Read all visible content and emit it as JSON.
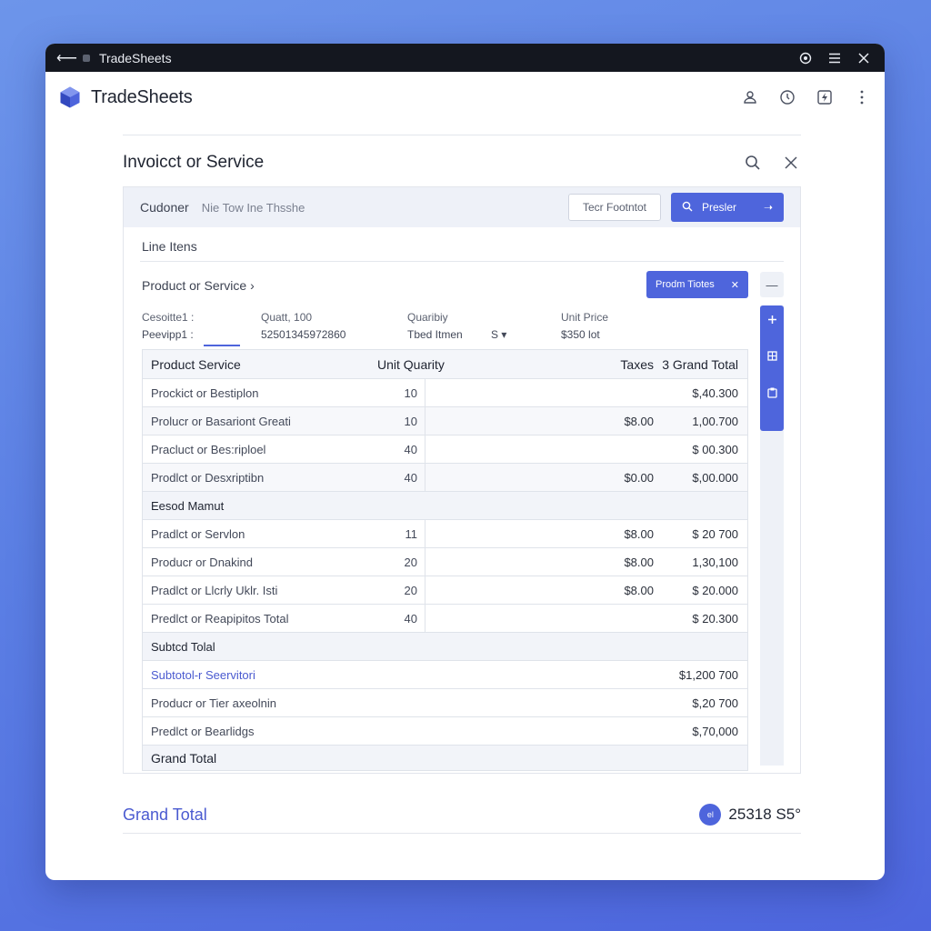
{
  "window": {
    "title": "TradeSheets"
  },
  "app": {
    "brand": "TradeSheets"
  },
  "dialog": {
    "title": "Invoicct or Service"
  },
  "filter": {
    "label": "Cudoner",
    "placeholder": "Nie Tow Ine Thsshe",
    "secondary_btn": "Tecr Footntot",
    "primary_btn": "Presler"
  },
  "line_items": {
    "label": "Line Itens"
  },
  "product": {
    "label": "Product or Service",
    "button": "Prodm Tiotes"
  },
  "meta": {
    "row1": [
      "Cesoitte1 :",
      "Quatt, 100",
      "Quaribiy",
      "Unit Price"
    ],
    "row2": [
      "Peevipp1 :",
      "52501345972860",
      "Tbed Itmen",
      "S",
      "$350 lot"
    ]
  },
  "table": {
    "headers": {
      "desc": "Product Service",
      "qty": "Unit Quarity",
      "tax": "Taxes",
      "total": "Grand Total",
      "total_prefix": "3"
    },
    "rows1": [
      {
        "desc": "Prockict or Bestiplon",
        "qty": "10",
        "tax": "",
        "total": "$,40.300"
      },
      {
        "desc": "Prolucr or Basariont Greati",
        "qty": "10",
        "tax": "$8.00",
        "total": "1,00.700"
      },
      {
        "desc": "Pracluct or Bes:riploel",
        "qty": "40",
        "tax": "",
        "total": "$ 00.300"
      },
      {
        "desc": "Prodlct or Desxriptibn",
        "qty": "40",
        "tax": "$0.00",
        "total": "$,00.000"
      }
    ],
    "group1": "Eesod Mamut",
    "rows2": [
      {
        "desc": "Pradlct or Servlon",
        "qty": "11",
        "tax": "$8.00",
        "total": "$ 20 700"
      },
      {
        "desc": "Producr or Dnakind",
        "qty": "20",
        "tax": "$8.00",
        "total": "1,30,100"
      },
      {
        "desc": "Pradlct or Llcrly Uklr. Isti",
        "qty": "20",
        "tax": "$8.00",
        "total": "$ 20.000"
      },
      {
        "desc": "Predlct or Reapipitos Total",
        "qty": "40",
        "tax": "",
        "total": "$ 20.300"
      }
    ],
    "group2": "Subtcd Tolal",
    "rows3": [
      {
        "desc": "Subtotol-r Seervitori",
        "total": "$1,200 700"
      },
      {
        "desc": "Producr or Tier axeolnin",
        "total": "$,20 700"
      },
      {
        "desc": "Predlct or Bearlidgs",
        "total": "$,70,000"
      }
    ],
    "group3": "Grand Total"
  },
  "footer": {
    "label": "Grand Total",
    "badge": "el",
    "value": "25318 S5°"
  },
  "icons": {
    "titlebar": [
      "back-arrow-icon",
      "record-icon",
      "menu-icon",
      "close-icon"
    ],
    "appbar": [
      "user-icon",
      "clock-icon",
      "bolt-icon",
      "more-icon"
    ],
    "side": [
      "plus-icon",
      "grid-icon",
      "clipboard-icon"
    ]
  },
  "colors": {
    "accent": "#4e65dc",
    "titlebar": "#14171f"
  }
}
